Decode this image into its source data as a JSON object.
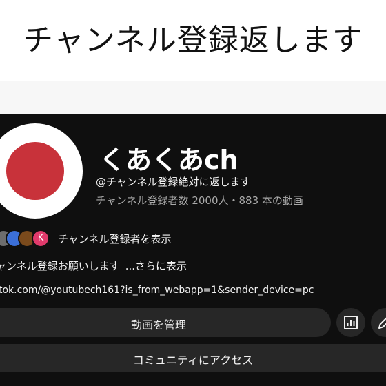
{
  "banner": {
    "title": "チャンネル登録返します"
  },
  "channel": {
    "avatar_color": "#c8323a",
    "name": "くあくあch",
    "handle": "@チャンネル登録絶対に返します",
    "stats": "チャンネル登録者数 2000人・883 本の動画"
  },
  "subscribers": {
    "avatar_letter": "K",
    "label": "チャンネル登録者を表示"
  },
  "description": {
    "text": "ャンネル登録お願いします",
    "more": "...さらに表示"
  },
  "link": {
    "text": "tok.com/@youtubech161?is_from_webapp=1&sender_device=pc"
  },
  "actions": {
    "manage_label": "動画を管理",
    "analytics_icon": "analytics-icon",
    "edit_icon": "pencil-icon",
    "community_label": "コミュニティにアクセス"
  },
  "colors": {
    "background": "#0f0f0f",
    "button": "#272727",
    "accent_red": "#c8323a"
  }
}
